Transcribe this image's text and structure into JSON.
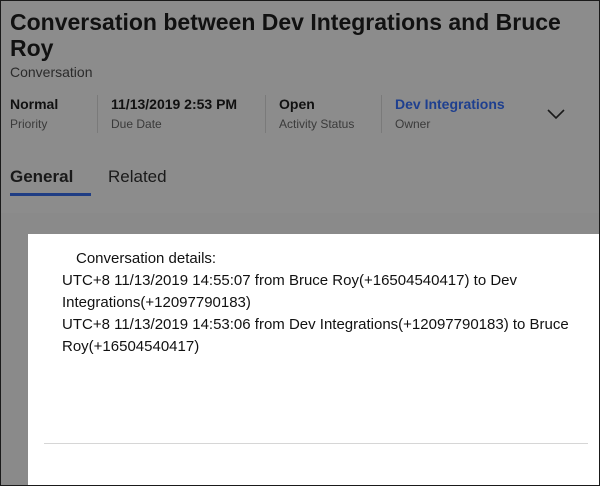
{
  "header": {
    "title": "Conversation between Dev Integrations and Bruce Roy",
    "entity_type": "Conversation"
  },
  "fields": {
    "priority": {
      "value": "Normal",
      "label": "Priority"
    },
    "due_date": {
      "value": "11/13/2019 2:53 PM",
      "label": "Due Date"
    },
    "activity_status": {
      "value": "Open",
      "label": "Activity Status"
    },
    "owner": {
      "value": "Dev Integrations",
      "label": "Owner"
    }
  },
  "expand_icon": "chevron-down-icon",
  "tabs": [
    {
      "label": "General",
      "active": true
    },
    {
      "label": "Related",
      "active": false
    }
  ],
  "details": {
    "heading": "Conversation details:",
    "entry_1": "UTC+8 11/13/2019 14:55:07 from Bruce Roy(+16504540417) to Dev Integrations(+12097790183)",
    "entry_2": "UTC+8 11/13/2019 14:53:06 from Dev Integrations(+12097790183) to Bruce Roy(+16504540417)"
  },
  "colors": {
    "header_background": "#8c8c8c",
    "panel_background": "#ffffff",
    "tab_underline": "#1f3d84",
    "owner_link": "#1e3f8f"
  }
}
